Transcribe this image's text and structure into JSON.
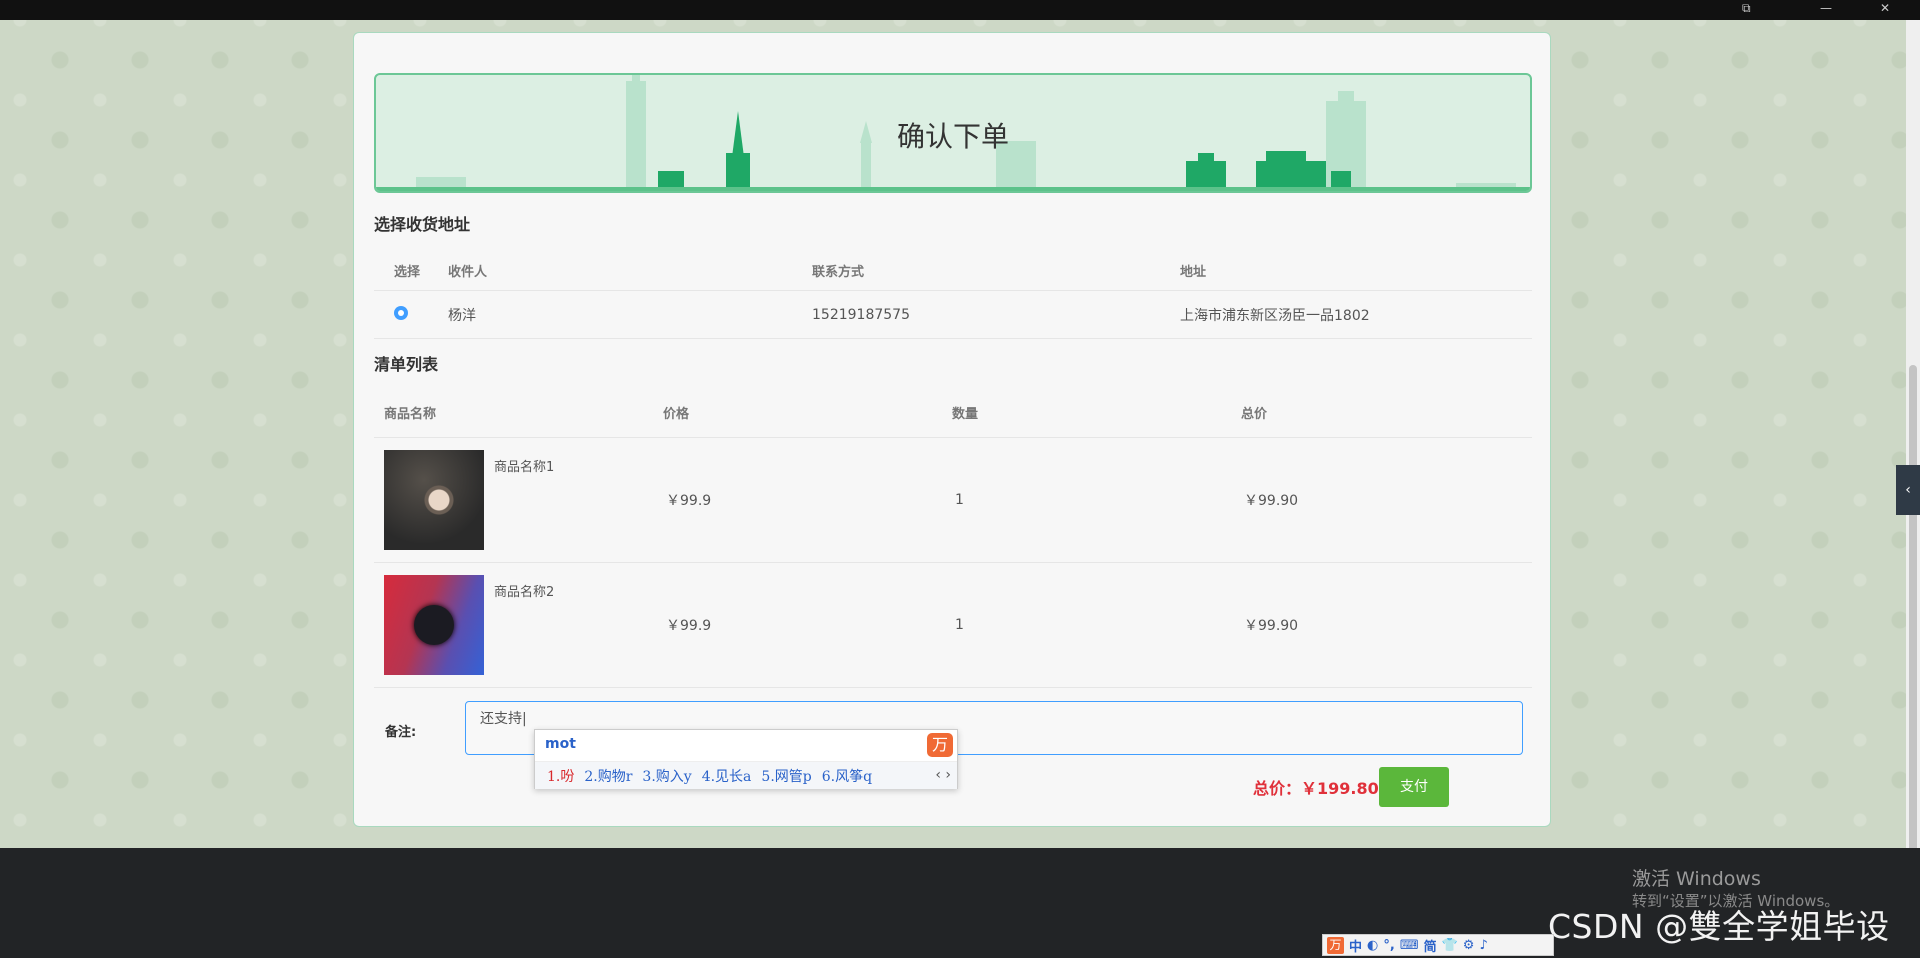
{
  "window": {
    "title": "",
    "controls": [
      "⧉",
      "—",
      "✕"
    ]
  },
  "banner": {
    "title": "确认下单"
  },
  "address_section": {
    "title": "选择收货地址",
    "columns": [
      "选择",
      "收件人",
      "联系方式",
      "地址"
    ],
    "rows": [
      {
        "selected": true,
        "name": "杨洋",
        "phone": "15219187575",
        "address": "上海市浦东新区汤臣一品1802"
      }
    ]
  },
  "order_section": {
    "title": "清单列表",
    "columns": [
      "商品名称",
      "价格",
      "数量",
      "总价"
    ],
    "items": [
      {
        "name": "商品名称1",
        "price": "￥99.9",
        "qty": "1",
        "total": "￥99.90"
      },
      {
        "name": "商品名称2",
        "price": "￥99.9",
        "qty": "1",
        "total": "￥99.90"
      }
    ]
  },
  "remark": {
    "label": "备注:",
    "value": "还支持|"
  },
  "ime_popup": {
    "composition": "mot",
    "logo": "万",
    "candidates": [
      "1.吩",
      "2.购物r",
      "3.购入y",
      "4.见长a",
      "5.网管p",
      "6.风筝q"
    ],
    "arrows": "‹ ›"
  },
  "summary": {
    "total_label": "总价：￥199.80",
    "pay_label": "支付"
  },
  "watermark": {
    "line1": "激活 Windows",
    "line2": "转到“设置”以激活 Windows。"
  },
  "csdn": "CSDN @雙全学姐毕设",
  "ime_tray": {
    "logo": "万",
    "items": [
      "中",
      "◐",
      "°,",
      "⌨",
      "简",
      "👕",
      "⚙",
      "♪"
    ]
  },
  "side_tab": {
    "label": "‹"
  },
  "colors": {
    "accent": "#409eff",
    "pay": "#5bb73b",
    "total": "#e0303a",
    "banner": "#dcefe3"
  }
}
